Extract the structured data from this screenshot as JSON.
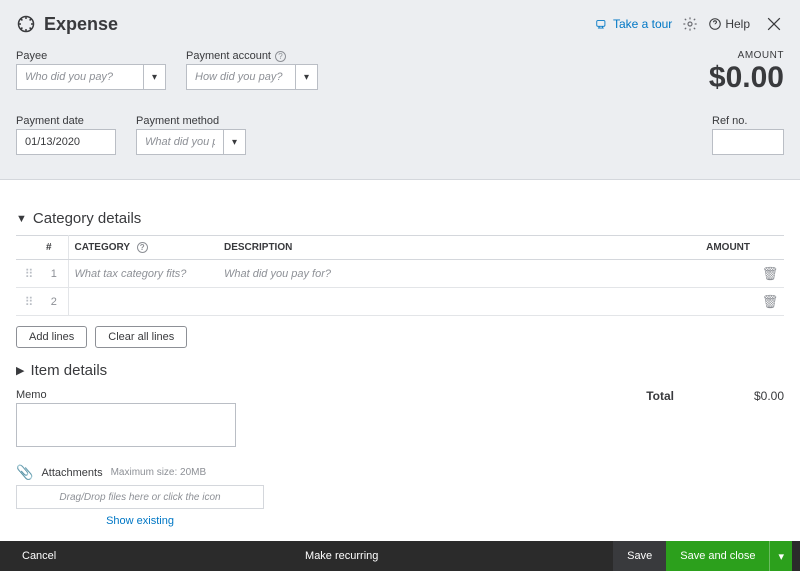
{
  "header": {
    "title": "Expense",
    "take_tour": "Take a tour",
    "help": "Help"
  },
  "form": {
    "payee_label": "Payee",
    "payee_placeholder": "Who did you pay?",
    "payment_account_label": "Payment account",
    "payment_account_placeholder": "How did you pay?",
    "amount_label": "AMOUNT",
    "amount_value": "$0.00",
    "payment_date_label": "Payment date",
    "payment_date_value": "01/13/2020",
    "payment_method_label": "Payment method",
    "payment_method_placeholder": "What did you pay with?",
    "ref_no_label": "Ref no."
  },
  "category": {
    "section_title": "Category details",
    "columns": {
      "num": "#",
      "category": "CATEGORY",
      "description": "DESCRIPTION",
      "amount": "AMOUNT"
    },
    "rows": [
      {
        "num": "1",
        "category_placeholder": "What tax category fits?",
        "description_placeholder": "What did you pay for?"
      },
      {
        "num": "2",
        "category_placeholder": "",
        "description_placeholder": ""
      }
    ],
    "add_lines": "Add lines",
    "clear_all": "Clear all lines"
  },
  "items": {
    "section_title": "Item details"
  },
  "memo": {
    "label": "Memo"
  },
  "total": {
    "label": "Total",
    "value": "$0.00"
  },
  "attachments": {
    "label": "Attachments",
    "note": "Maximum size: 20MB",
    "dropzone": "Drag/Drop files here or click the icon",
    "show_existing": "Show existing"
  },
  "footer": {
    "cancel": "Cancel",
    "make_recurring": "Make recurring",
    "save": "Save",
    "save_and_close": "Save and close"
  }
}
